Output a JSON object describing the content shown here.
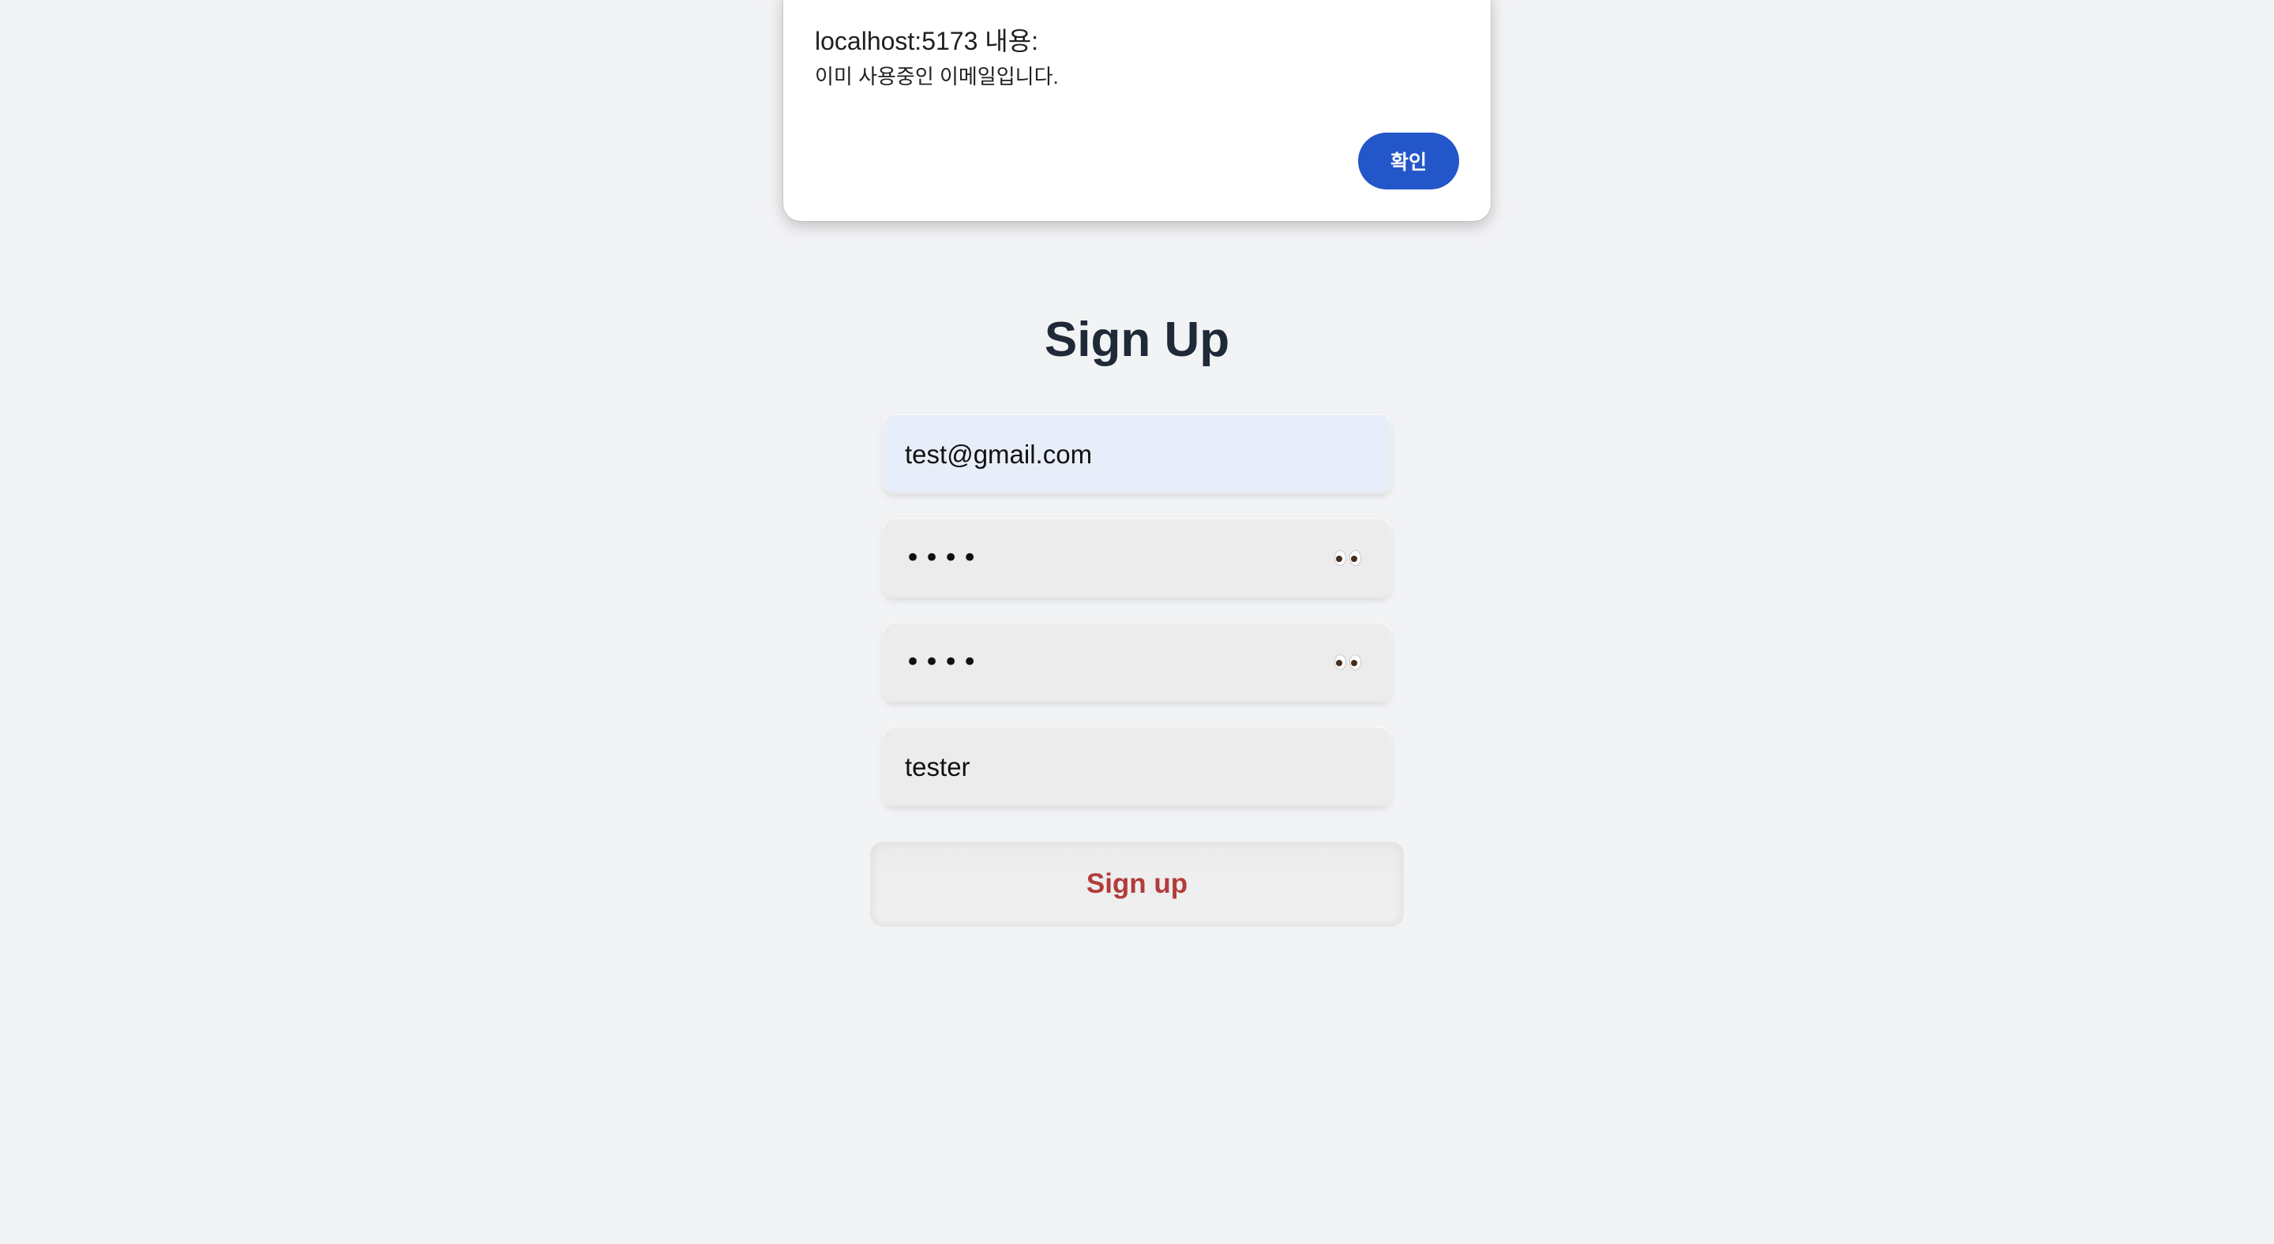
{
  "alert": {
    "title": "localhost:5173 내용:",
    "message": "이미 사용중인 이메일입니다.",
    "ok_label": "확인"
  },
  "form": {
    "title": "Sign Up",
    "email_value": "test@gmail.com",
    "password_masked": "••••",
    "password_confirm_masked": "••••",
    "nickname_value": "tester",
    "submit_label": "Sign up",
    "toggle_icon": "eyes-icon"
  },
  "colors": {
    "background": "#f2f3f5",
    "alert_button": "#2356c8",
    "submit_text": "#b23b3b",
    "title_text": "#1f2937",
    "email_field_bg": "#e8eef9",
    "field_bg": "#ececec"
  }
}
